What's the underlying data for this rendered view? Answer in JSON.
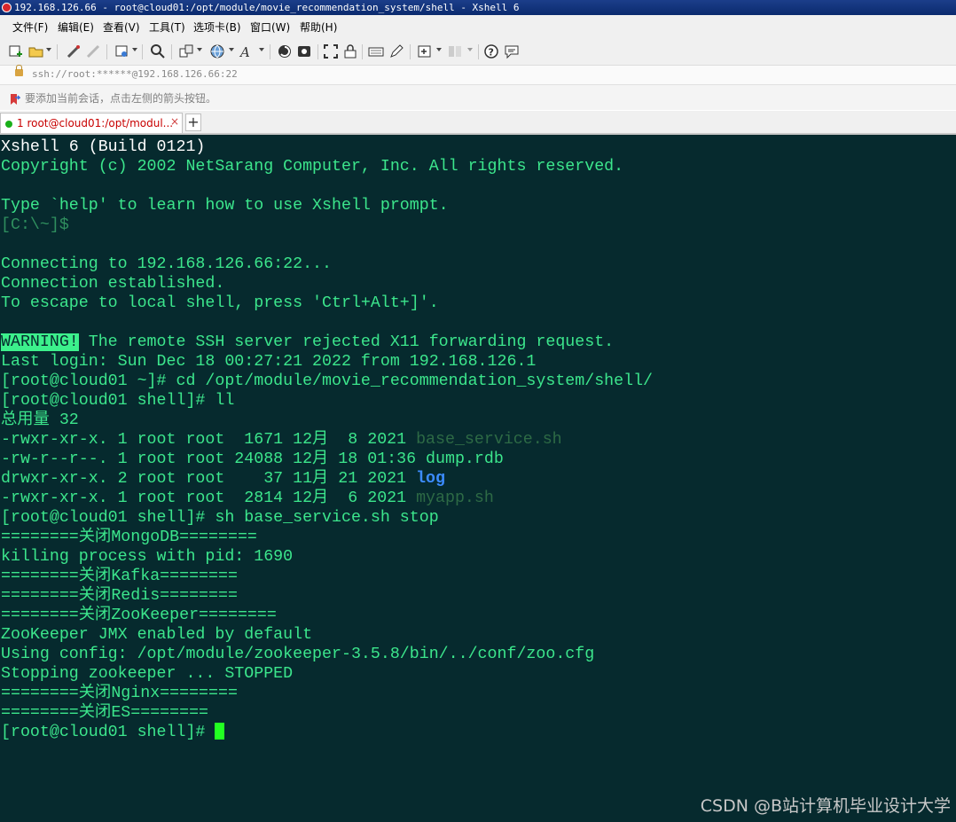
{
  "window": {
    "title": "192.168.126.66 - root@cloud01:/opt/module/movie_recommendation_system/shell - Xshell 6"
  },
  "menu": [
    "文件(F)",
    "编辑(E)",
    "查看(V)",
    "工具(T)",
    "选项卡(B)",
    "窗口(W)",
    "帮助(H)"
  ],
  "address": "ssh://root:******@192.168.126.66:22",
  "hint": "要添加当前会话，点击左侧的箭头按钮。",
  "tab": {
    "label": "1 root@cloud01:/opt/modul...",
    "close": "×",
    "new": "+"
  },
  "terminal": {
    "header": [
      "Xshell 6 (Build 0121)",
      "Copyright (c) 2002 NetSarang Computer, Inc. All rights reserved."
    ],
    "help_line": "Type `help' to learn how to use Xshell prompt.",
    "local_prompt": "[C:\\~]$",
    "connect": [
      "Connecting to 192.168.126.66:22...",
      "Connection established.",
      "To escape to local shell, press 'Ctrl+Alt+]'."
    ],
    "warning_label": "WARNING!",
    "warning_text": " The remote SSH server rejected X11 forwarding request.",
    "last_login": "Last login: Sun Dec 18 00:27:21 2022 from 192.168.126.1",
    "cmd1": "[root@cloud01 ~]# cd /opt/module/movie_recommendation_system/shell/",
    "cmd2": "[root@cloud01 shell]# ll",
    "total": "总用量 32",
    "files": [
      {
        "meta": "-rwxr-xr-x. 1 root root  1671 12月  8 2021 ",
        "name": "base_service.sh"
      },
      {
        "meta": "-rw-r--r--. 1 root root 24088 12月 18 01:36 ",
        "name": "dump.rdb"
      },
      {
        "meta": "drwxr-xr-x. 2 root root    37 11月 21 2021 ",
        "name": "log"
      },
      {
        "meta": "-rwxr-xr-x. 1 root root  2814 12月  6 2021 ",
        "name": "myapp.sh"
      }
    ],
    "cmd3": "[root@cloud01 shell]# sh base_service.sh stop",
    "output": [
      "========关闭MongoDB========",
      "killing process with pid: 1690",
      "========关闭Kafka========",
      "========关闭Redis========",
      "========关闭ZooKeeper========",
      "ZooKeeper JMX enabled by default",
      "Using config: /opt/module/zookeeper-3.5.8/bin/../conf/zoo.cfg",
      "Stopping zookeeper ... STOPPED",
      "========关闭Nginx========",
      "========关闭ES========"
    ],
    "final_prompt": "[root@cloud01 shell]# "
  },
  "watermark": "CSDN @B站计算机毕业设计大学"
}
